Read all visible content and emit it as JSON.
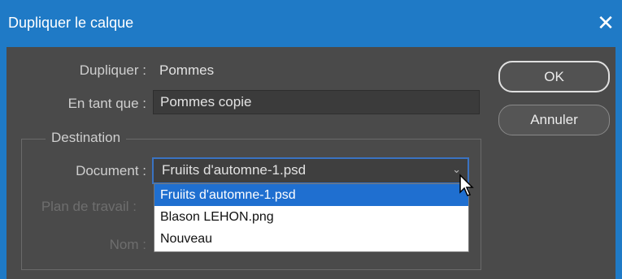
{
  "dialog": {
    "title": "Dupliquer le calque",
    "close_icon": "close-icon"
  },
  "duplicate": {
    "label": "Dupliquer :",
    "value": "Pommes"
  },
  "as": {
    "label": "En tant que :",
    "value": "Pommes copie"
  },
  "destination": {
    "legend": "Destination",
    "document_label": "Document :",
    "document_value": "Fruiits d'automne-1.psd",
    "options": [
      "Fruiits d'automne-1.psd",
      "Blason LEHON.png",
      "Nouveau"
    ],
    "selected_index": 0,
    "artboard_label": "Plan de travail :",
    "name_label": "Nom :"
  },
  "buttons": {
    "ok": "OK",
    "cancel": "Annuler"
  },
  "colors": {
    "accent": "#1f7ac6",
    "highlight": "#1f6fd0",
    "background": "#4a4a4a"
  }
}
